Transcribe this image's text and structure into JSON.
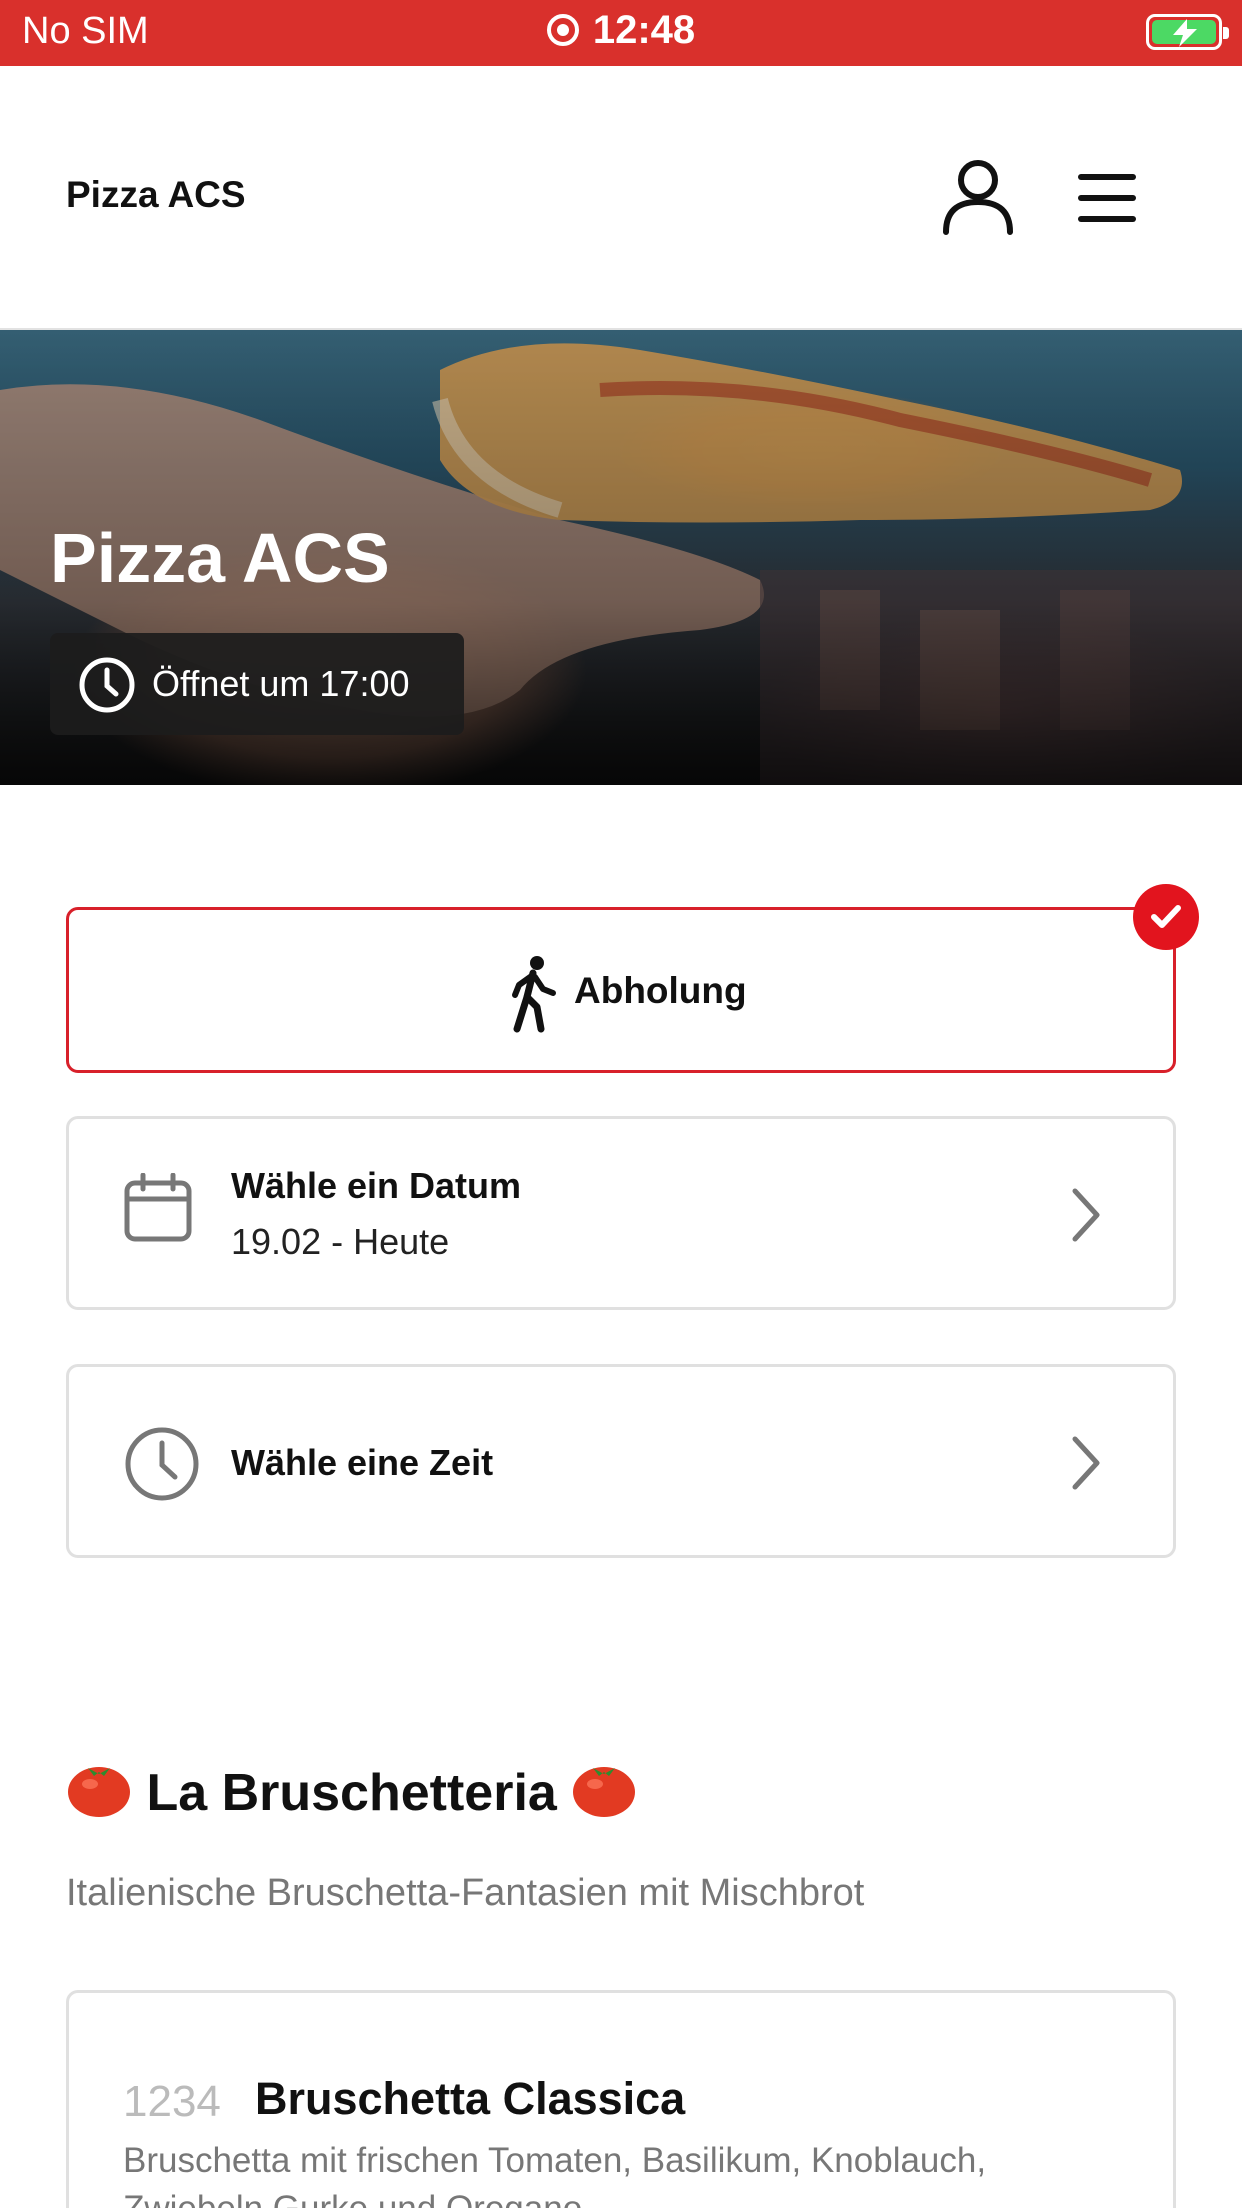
{
  "status_bar": {
    "carrier": "No SIM",
    "time": "12:48",
    "battery_color": "#4cd964"
  },
  "header": {
    "brand": "Pizza ACS",
    "user_icon": "user-icon",
    "menu_icon": "hamburger-menu-icon"
  },
  "hero": {
    "title": "Pizza ACS",
    "hours": "Öffnet um 17:00"
  },
  "order_type": {
    "label": "Abholung",
    "selected": true,
    "accent_color": "#d8202a"
  },
  "date_selector": {
    "title": "Wähle ein Datum",
    "value": "19.02 - Heute"
  },
  "time_selector": {
    "title": "Wähle eine Zeit"
  },
  "section": {
    "title": "La Bruschetteria",
    "description": "Italienische Bruschetta-Fantasien mit Mischbrot"
  },
  "menu_item": {
    "number": "1234",
    "name": "Bruschetta Classica",
    "description": "Bruschetta mit frischen Tomaten, Basilikum, Knoblauch, Zwiebeln,Gurke und Oregano"
  }
}
